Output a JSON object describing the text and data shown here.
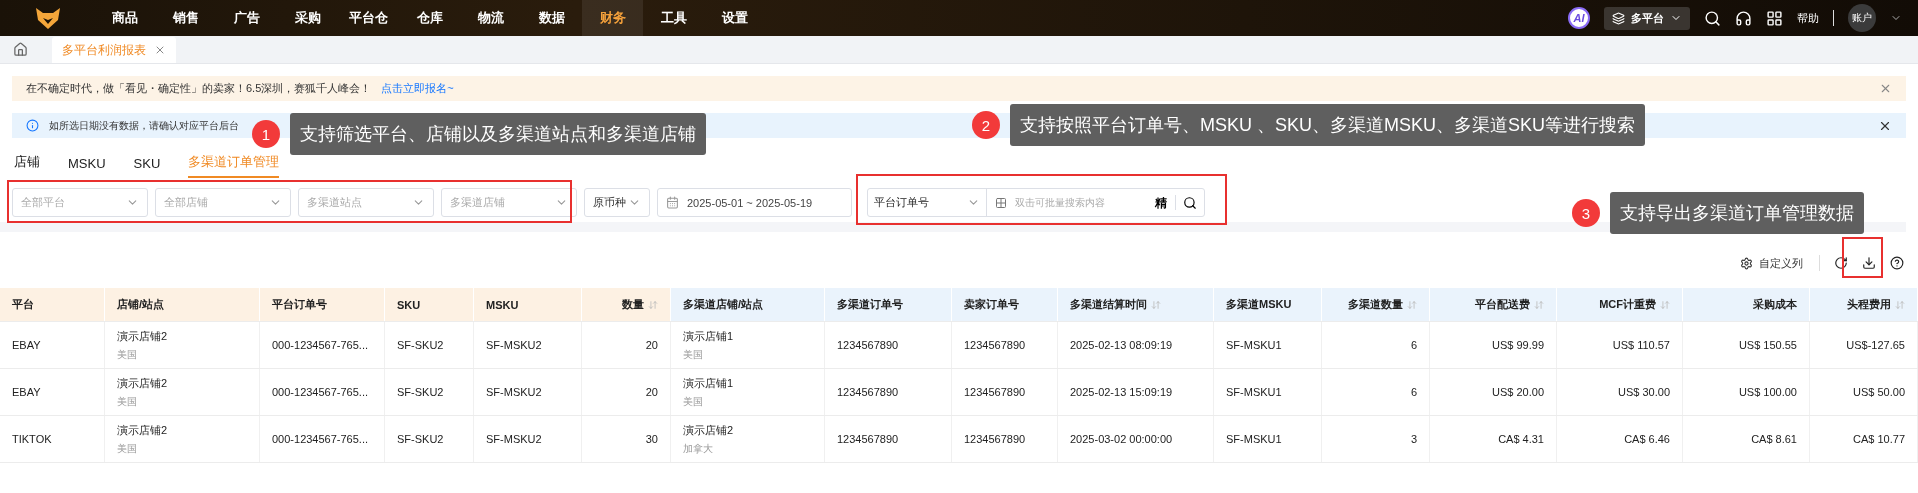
{
  "nav": {
    "items": [
      {
        "label": "商品",
        "selected": false
      },
      {
        "label": "销售",
        "selected": false
      },
      {
        "label": "广告",
        "selected": false
      },
      {
        "label": "采购",
        "selected": false
      },
      {
        "label": "平台仓",
        "selected": false
      },
      {
        "label": "仓库",
        "selected": false
      },
      {
        "label": "物流",
        "selected": false
      },
      {
        "label": "数据",
        "selected": false
      },
      {
        "label": "财务",
        "selected": true
      },
      {
        "label": "工具",
        "selected": false
      },
      {
        "label": "设置",
        "selected": false
      }
    ],
    "ai": "AI",
    "platform": "多平台",
    "help": "帮助",
    "account": "账户"
  },
  "page_tabs": [
    {
      "label": "多平台利润报表",
      "selected": true
    }
  ],
  "promo": {
    "text": "在不确定时代，做「看见・确定性」的卖家！6.5深圳，赛狐千人峰会！",
    "link": "点击立即报名~"
  },
  "info": {
    "text": "如所选日期没有数据，请确认对应平台后台"
  },
  "sub_tabs": [
    {
      "label": "店铺",
      "selected": false
    },
    {
      "label": "MSKU",
      "selected": false
    },
    {
      "label": "SKU",
      "selected": false
    },
    {
      "label": "多渠道订单管理",
      "selected": true
    }
  ],
  "filters": [
    {
      "kind": "select",
      "placeholder": "全部平台"
    },
    {
      "kind": "select",
      "placeholder": "全部店铺"
    },
    {
      "kind": "select",
      "placeholder": "多渠道站点"
    },
    {
      "kind": "select",
      "placeholder": "多渠道店铺"
    },
    {
      "kind": "select",
      "value": "原币种"
    },
    {
      "kind": "date",
      "start": "2025-05-01",
      "separator": "~",
      "end": "2025-05-19"
    }
  ],
  "search": {
    "type": "平台订单号",
    "placeholder": "双击可批量搜索内容",
    "exact": "精"
  },
  "toolbar": {
    "custom_columns": "自定义列"
  },
  "table": {
    "columns": [
      {
        "label": "平台",
        "sortable": false
      },
      {
        "label": "店铺/站点",
        "sortable": false
      },
      {
        "label": "平台订单号",
        "sortable": false
      },
      {
        "label": "SKU",
        "sortable": false
      },
      {
        "label": "MSKU",
        "sortable": false
      },
      {
        "label": "数量",
        "sortable": true
      },
      {
        "label": "多渠道店铺/站点",
        "sortable": false
      },
      {
        "label": "多渠道订单号",
        "sortable": false
      },
      {
        "label": "卖家订单号",
        "sortable": false
      },
      {
        "label": "多渠道结算时间",
        "sortable": true
      },
      {
        "label": "多渠道MSKU",
        "sortable": false
      },
      {
        "label": "多渠道数量",
        "sortable": true
      },
      {
        "label": "平台配送费",
        "sortable": true
      },
      {
        "label": "MCF计重费",
        "sortable": true
      },
      {
        "label": "采购成本",
        "sortable": false
      },
      {
        "label": "头程费用",
        "sortable": true
      }
    ],
    "rows": [
      {
        "cells": [
          {
            "text": "EBAY"
          },
          {
            "text": "演示店铺2",
            "sub": "美国"
          },
          {
            "text": "000-1234567-765..."
          },
          {
            "text": "SF-SKU2"
          },
          {
            "text": "SF-MSKU2"
          },
          {
            "text": "20"
          },
          {
            "text": "演示店铺1",
            "sub": "美国"
          },
          {
            "text": "1234567890"
          },
          {
            "text": "1234567890"
          },
          {
            "text": "2025-02-13 08:09:19"
          },
          {
            "text": "SF-MSKU1"
          },
          {
            "text": "6"
          },
          {
            "text": "US$ 99.99"
          },
          {
            "text": "US$ 110.57"
          },
          {
            "text": "US$ 150.55"
          },
          {
            "text": "US$-127.65"
          }
        ]
      },
      {
        "cells": [
          {
            "text": "EBAY"
          },
          {
            "text": "演示店铺2",
            "sub": "美国"
          },
          {
            "text": "000-1234567-765..."
          },
          {
            "text": "SF-SKU2"
          },
          {
            "text": "SF-MSKU2"
          },
          {
            "text": "20"
          },
          {
            "text": "演示店铺1",
            "sub": "美国"
          },
          {
            "text": "1234567890"
          },
          {
            "text": "1234567890"
          },
          {
            "text": "2025-02-13 15:09:19"
          },
          {
            "text": "SF-MSKU1"
          },
          {
            "text": "6"
          },
          {
            "text": "US$ 20.00"
          },
          {
            "text": "US$ 30.00"
          },
          {
            "text": "US$ 100.00"
          },
          {
            "text": "US$ 50.00"
          }
        ]
      },
      {
        "cells": [
          {
            "text": "TIKTOK"
          },
          {
            "text": "演示店铺2",
            "sub": "美国"
          },
          {
            "text": "000-1234567-765..."
          },
          {
            "text": "SF-SKU2"
          },
          {
            "text": "SF-MSKU2"
          },
          {
            "text": "30"
          },
          {
            "text": "演示店铺2",
            "sub": "加拿大"
          },
          {
            "text": "1234567890"
          },
          {
            "text": "1234567890"
          },
          {
            "text": "2025-03-02 00:00:00"
          },
          {
            "text": "SF-MSKU1"
          },
          {
            "text": "3"
          },
          {
            "text": "CA$ 4.31"
          },
          {
            "text": "CA$ 6.46"
          },
          {
            "text": "CA$ 8.61"
          },
          {
            "text": "CA$ 10.77"
          }
        ]
      }
    ]
  },
  "callouts": [
    {
      "number": "1",
      "text": "支持筛选平台、店铺以及多渠道站点和多渠道店铺"
    },
    {
      "number": "2",
      "text": "支持按照平台订单号、MSKU 、SKU、多渠道MSKU、多渠道SKU等进行搜索"
    },
    {
      "number": "3",
      "text": "支持导出多渠道订单管理数据"
    }
  ]
}
